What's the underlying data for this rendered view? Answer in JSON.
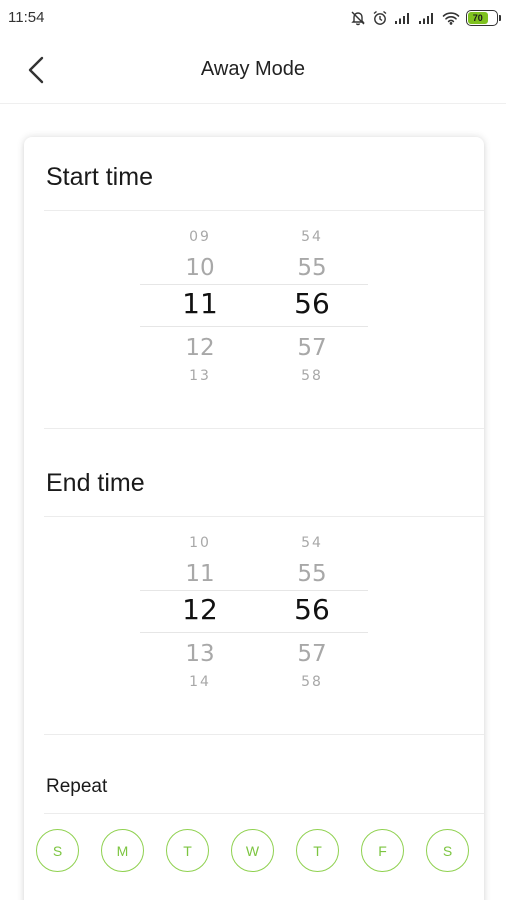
{
  "status_bar": {
    "time": "11:54",
    "battery": "70"
  },
  "header": {
    "title": "Away Mode"
  },
  "start": {
    "title": "Start time",
    "hours": [
      "09",
      "10",
      "11",
      "12",
      "13"
    ],
    "minutes": [
      "54",
      "55",
      "56",
      "57",
      "58"
    ]
  },
  "end": {
    "title": "End time",
    "hours": [
      "10",
      "11",
      "12",
      "13",
      "14"
    ],
    "minutes": [
      "54",
      "55",
      "56",
      "57",
      "58"
    ]
  },
  "repeat": {
    "label": "Repeat",
    "days": [
      "S",
      "M",
      "T",
      "W",
      "T",
      "F",
      "S"
    ]
  },
  "colors": {
    "accent": "#8fd14f",
    "battery_fill": "#7fc21f"
  }
}
